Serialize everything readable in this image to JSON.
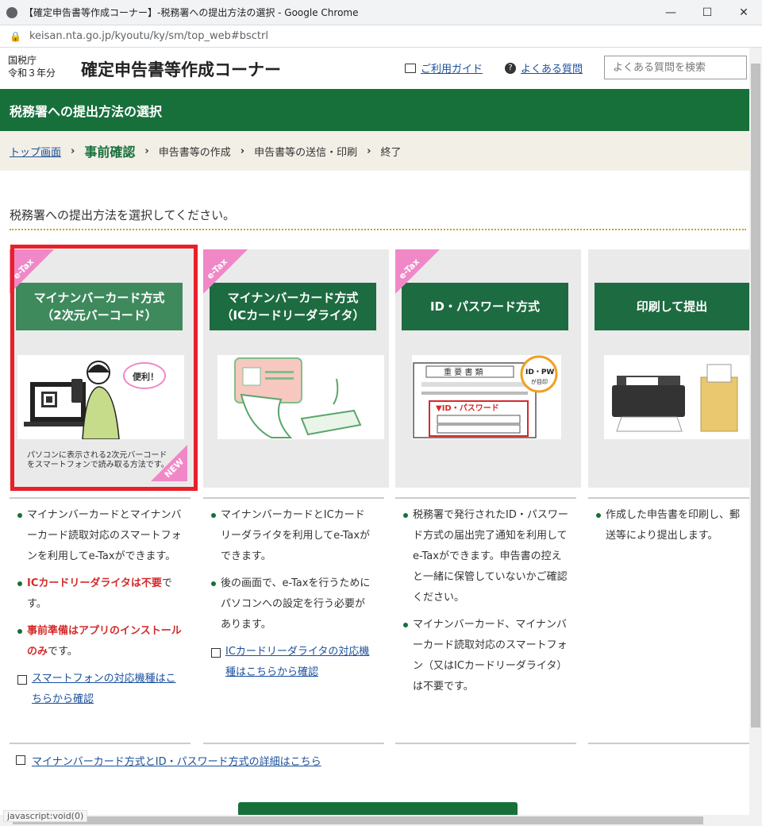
{
  "window": {
    "title": "【確定申告書等作成コーナー】-税務署への提出方法の選択 - Google Chrome",
    "minimize": "—",
    "maximize": "☐",
    "close": "✕"
  },
  "address": {
    "url": "keisan.nta.go.jp/kyoutu/ky/sm/top_web#bsctrl"
  },
  "header": {
    "agency": "国税庁",
    "year": "令和３年分",
    "title": "確定申告書等作成コーナー",
    "guide": "ご利用ガイド",
    "faq": "よくある質問",
    "search_placeholder": "よくある質問を検索"
  },
  "greenbar": {
    "title": "税務署への提出方法の選択"
  },
  "breadcrumb": {
    "top": "トップ画面",
    "current": "事前確認",
    "step3": "申告書等の作成",
    "step4": "申告書等の送信・印刷",
    "step5": "終了",
    "sep": "›"
  },
  "instruction": "税務署への提出方法を選択してください。",
  "cards": [
    {
      "tag": "e-Tax",
      "line1": "マイナンバーカード方式",
      "line2": "（2次元バーコード）",
      "badge": "NEW",
      "caption1": "パソコンに表示される2次元バーコード",
      "caption2": "をスマートフォンで読み取る方法です。"
    },
    {
      "tag": "e-Tax",
      "line1": "マイナンバーカード方式",
      "line2": "（ICカードリーダライタ）"
    },
    {
      "tag": "e-Tax",
      "line1": "ID・パスワード方式"
    },
    {
      "line1": "印刷して提出"
    }
  ],
  "desc": {
    "c1": {
      "b1": "マイナンバーカードとマイナンバーカード読取対応のスマートフォンを利用してe-Taxができます。",
      "b2a": "ICカードリーダライタは不要",
      "b2b": "です。",
      "b3a": "事前準備はアプリのインストールのみ",
      "b3b": "です。",
      "link": "スマートフォンの対応機種はこちらから確認"
    },
    "c2": {
      "b1": "マイナンバーカードとICカードリーダライタを利用してe-Taxができます。",
      "b2": "後の画面で、e-Taxを行うためにパソコンへの設定を行う必要があります。",
      "link": "ICカードリーダライタの対応機種はこちらから確認"
    },
    "c3": {
      "b1": "税務署で発行されたID・パスワード方式の届出完了通知を利用してe-Taxができます。申告書の控えと一緒に保管していないかご確認ください。",
      "b2": "マイナンバーカード、マイナンバーカード読取対応のスマートフォン（又はICカードリーダライタ）は不要です。"
    },
    "c4": {
      "b1": "作成した申告書を印刷し、郵送等により提出します。"
    }
  },
  "detail_link": "マイナンバーカード方式とID・パスワード方式の詳細はこちら",
  "status": "javascript:void(0)",
  "pic": {
    "benri": "便利！",
    "idpw": "ID・PW",
    "idpw_sub": "が目印",
    "doc_title": "重 要 書 類",
    "doc_label": "▼ID・パスワード"
  }
}
